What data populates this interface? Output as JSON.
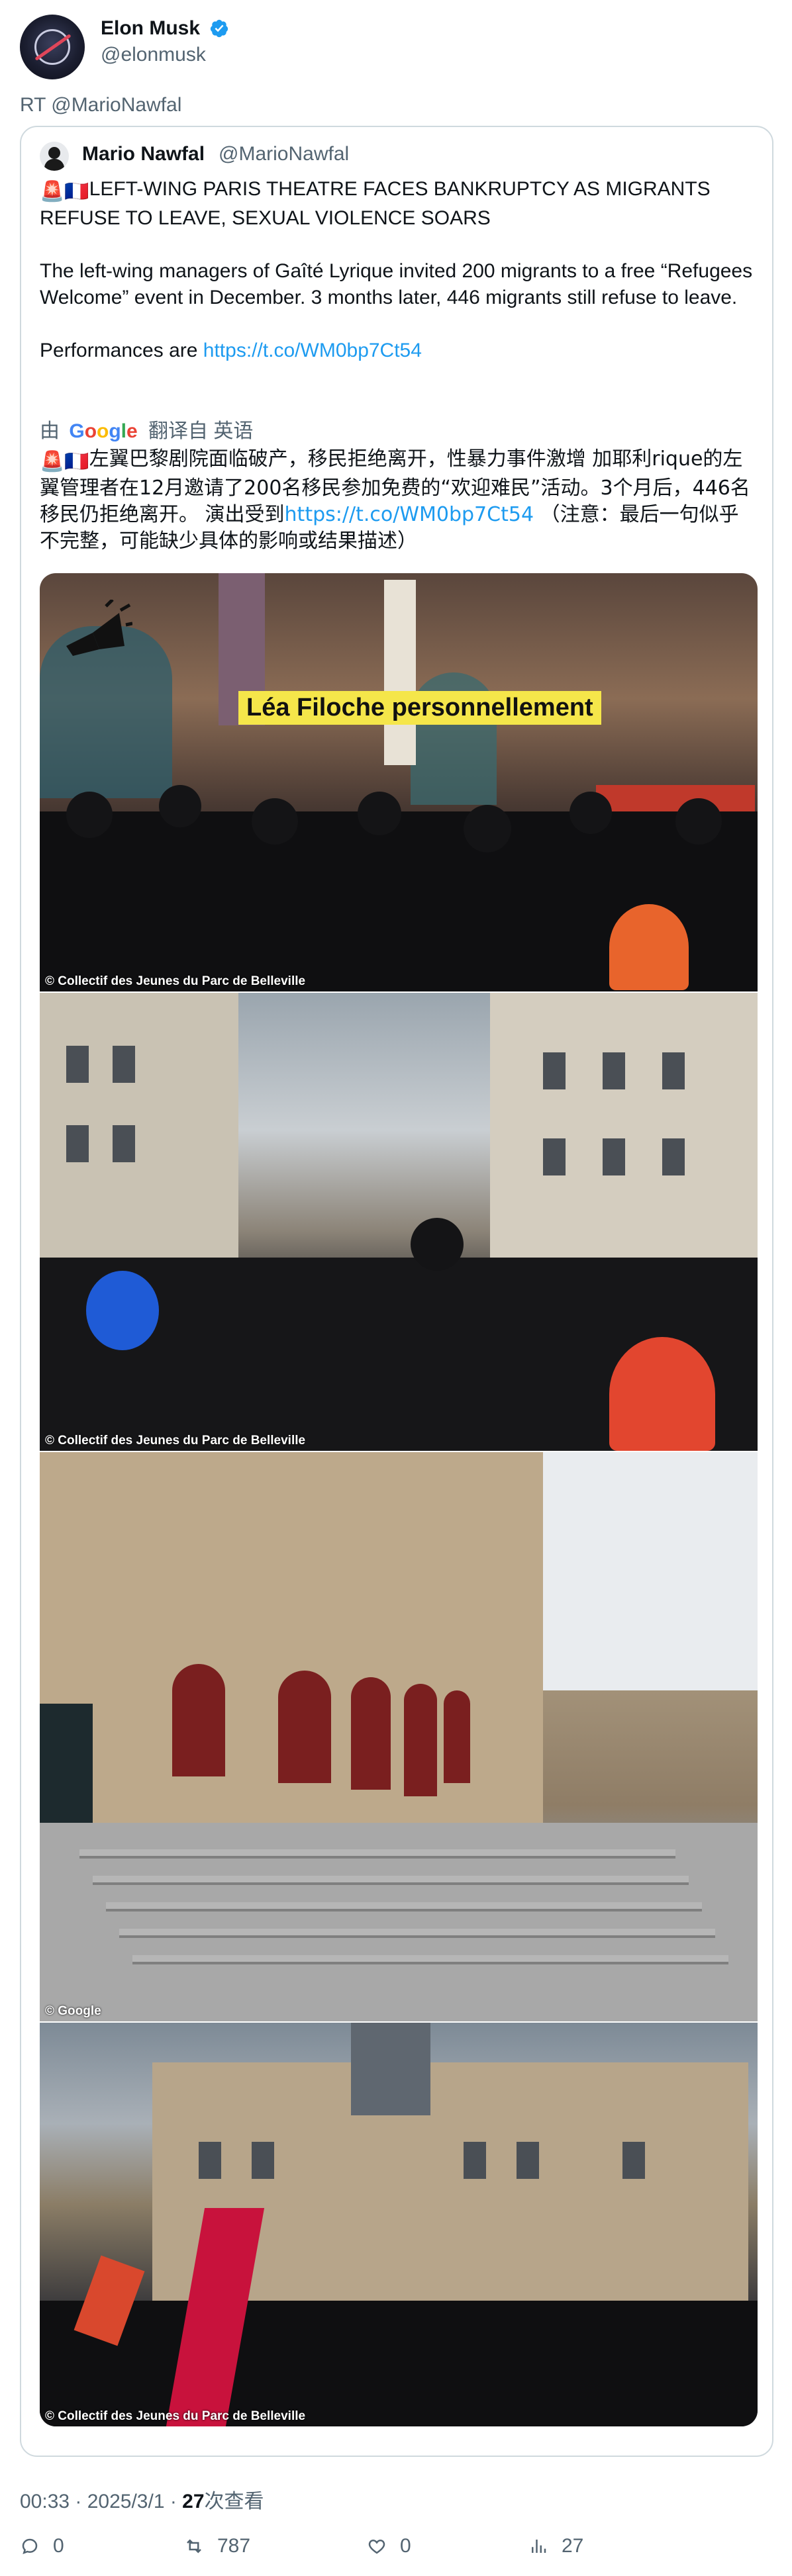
{
  "author": {
    "name": "Elon Musk",
    "handle": "@elonmusk"
  },
  "retweet_label": "RT @MarioNawfal",
  "quoted": {
    "name": "Mario Nawfal",
    "handle": "@MarioNawfal",
    "flags": "🚨🇫🇷",
    "headline": "LEFT-WING PARIS THEATRE FACES BANKRUPTCY AS MIGRANTS REFUSE TO LEAVE, SEXUAL VIOLENCE SOARS",
    "paragraph": "The left-wing managers of Gaîté Lyrique invited 200 migrants to a free “Refugees Welcome” event in December. 3 months later, 446 migrants still refuse to leave.",
    "performances_prefix": "Performances are ",
    "performances_link": "https://t.co/WM0bp7Ct54",
    "translation": {
      "by": "由",
      "google": "Google",
      "from": "翻译自 英语"
    },
    "translated_text": "左翼巴黎剧院面临破产，移民拒绝离开，性暴力事件激增 加耶利rique的左翼管理者在12月邀请了200名移民参加免费的“欢迎难民”活动。3个月后，446名移民仍拒绝离开。 演出受到",
    "translated_link": "https://t.co/WM0bp7Ct54",
    "translated_note": " （注意：最后一句似乎不完整，可能缺少具体的影响或结果描述）",
    "media": [
      {
        "caption": "Léa Filoche personnellement",
        "credit": "© Collectif des Jeunes du Parc de Belleville"
      },
      {
        "credit": "© Collectif des Jeunes du Parc de Belleville"
      },
      {
        "credit": "© Google"
      },
      {
        "credit": "© Collectif des Jeunes du Parc de Belleville"
      }
    ]
  },
  "meta": {
    "time": "00:33 · 2025/3/1 · ",
    "views_count": "27",
    "views_label": "次查看"
  },
  "actions": {
    "replies": "0",
    "retweets": "787",
    "likes": "0",
    "views": "27"
  },
  "colors": {
    "link": "#1d9bf0",
    "verified": "#1d9bf0",
    "secondary_text": "#536471"
  }
}
